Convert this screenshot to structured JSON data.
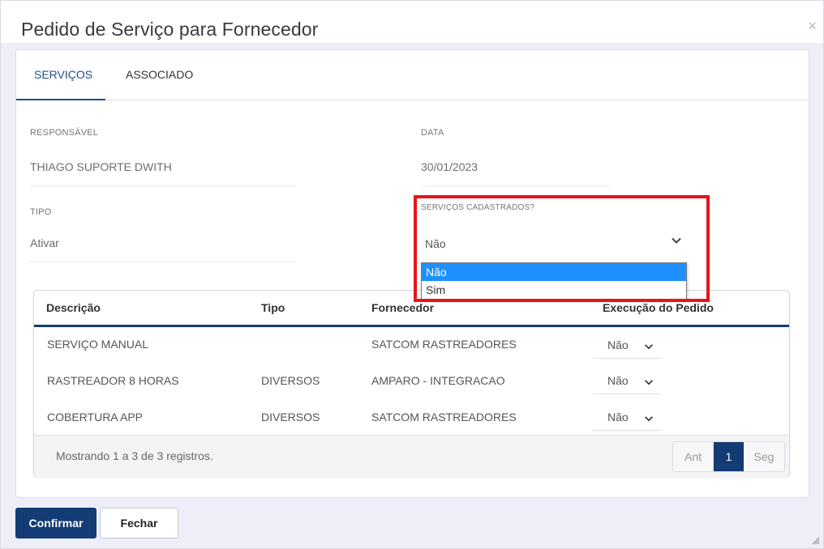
{
  "modal": {
    "title": "Pedido de Serviço para Fornecedor",
    "close_label": "×"
  },
  "tabs": [
    {
      "label": "SERVIÇOS",
      "active": true
    },
    {
      "label": "ASSOCIADO",
      "active": false
    }
  ],
  "form": {
    "responsavel": {
      "label": "RESPONSÁVEL",
      "value": "THIAGO SUPORTE DWITH"
    },
    "data": {
      "label": "DATA",
      "value": "30/01/2023"
    },
    "tipo": {
      "label": "TIPO",
      "value": "Ativar"
    },
    "servicos_cadastrados": {
      "label": "SERVIÇOS CADASTRADOS?",
      "value": "Não",
      "options": [
        "Não",
        "Sim"
      ],
      "highlighted_option": "Não"
    }
  },
  "table": {
    "columns": [
      "Descrição",
      "Tipo",
      "Fornecedor",
      "Execução do Pedido"
    ],
    "rows": [
      {
        "descricao": "SERVIÇO MANUAL",
        "tipo": "",
        "fornecedor": "SATCOM RASTREADORES",
        "execucao": "Não"
      },
      {
        "descricao": "RASTREADOR 8 HORAS",
        "tipo": "DIVERSOS",
        "fornecedor": "AMPARO - INTEGRACAO",
        "execucao": "Não"
      },
      {
        "descricao": "COBERTURA APP",
        "tipo": "DIVERSOS",
        "fornecedor": "SATCOM RASTREADORES",
        "execucao": "Não"
      }
    ],
    "footer_text": "Mostrando 1 a 3 de 3 registros.",
    "pager": {
      "prev": "Ant",
      "current": "1",
      "next": "Seg"
    }
  },
  "buttons": {
    "confirm": "Confirmar",
    "close": "Fechar"
  },
  "colors": {
    "primary": "#123c73",
    "highlight": "#e8141a",
    "option_selected": "#1e90ff"
  }
}
